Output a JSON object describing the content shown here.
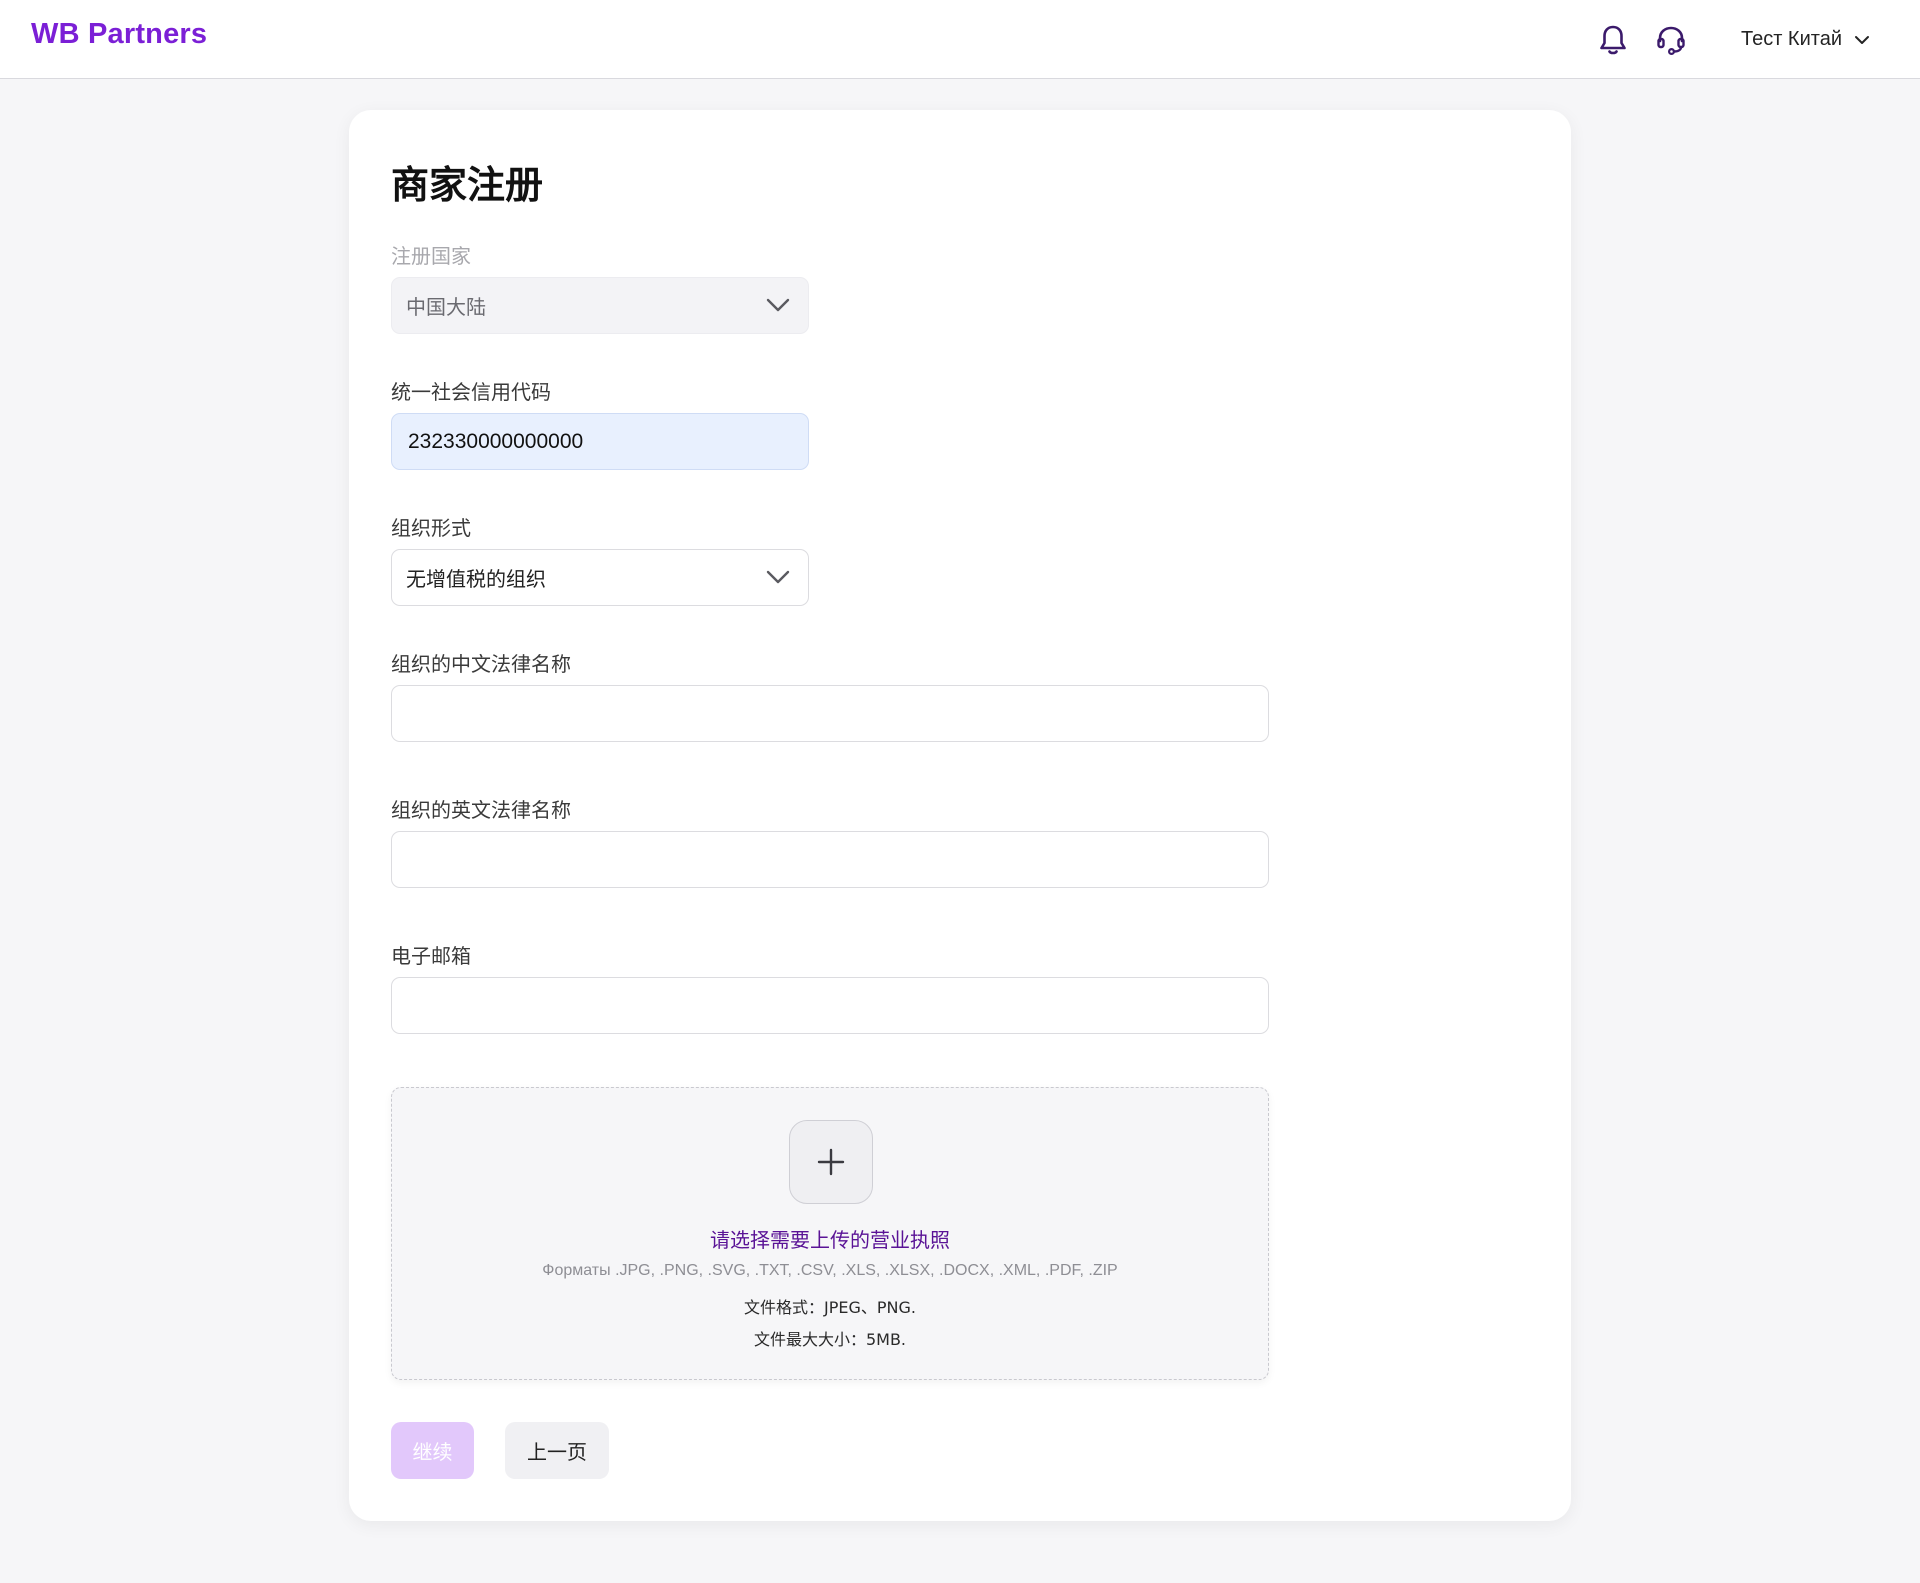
{
  "header": {
    "logo": "WB Partners",
    "profile_name": "Тест Китай",
    "icons": [
      "bell-icon",
      "headset-icon",
      "chevron-down-icon"
    ]
  },
  "form": {
    "title": "商家注册",
    "country": {
      "label": "注册国家",
      "value": "中国大陆"
    },
    "credit_code": {
      "label": "统一社会信用代码",
      "value": "232330000000000"
    },
    "org_form": {
      "label": "组织形式",
      "value": "无增值税的组织"
    },
    "cn_name": {
      "label": "组织的中文法律名称",
      "value": ""
    },
    "en_name": {
      "label": "组织的英文法律名称",
      "value": ""
    },
    "email": {
      "label": "电子邮箱",
      "value": ""
    },
    "upload": {
      "title": "请选择需要上传的营业执照",
      "formats": "Форматы .JPG, .PNG, .SVG, .TXT, .CSV, .XLS, .XLSX, .DOCX, .XML, .PDF, .ZIP",
      "file_format": "文件格式：JPEG、PNG.",
      "max_size": "文件最大大小：5MB."
    },
    "buttons": {
      "continue": "继续",
      "back": "上一页"
    }
  },
  "colors": {
    "brand": "#7b1fd6",
    "upload_link": "#5a1396",
    "continue_disabled": "#e2c8fb",
    "filled_input": "#e8f0fe"
  }
}
